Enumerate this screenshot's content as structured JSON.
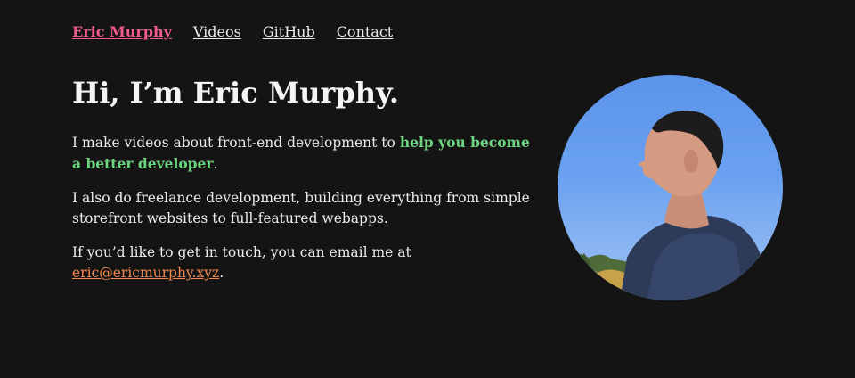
{
  "nav": {
    "brand": "Eric Murphy",
    "items": [
      "Videos",
      "GitHub",
      "Contact"
    ]
  },
  "hero": {
    "heading": "Hi, I’m Eric Murphy.",
    "p1_text": "I make videos about front-end development to ",
    "p1_highlight": "help you become a better developer",
    "p1_end": ".",
    "p2": "I also do freelance development, building everything from simple storefront websites to full-featured webapps.",
    "p3_text": "If you’d like to get in touch, you can email me at ",
    "email": "eric@ericmurphy.xyz",
    "p3_end": "."
  },
  "colors": {
    "background": "#141414",
    "brand": "#f05a8c",
    "highlight": "#6cd47f",
    "email": "#f0884f",
    "text": "#ececec"
  },
  "image": {
    "subject": "profile photo of man looking right against blue sky"
  }
}
